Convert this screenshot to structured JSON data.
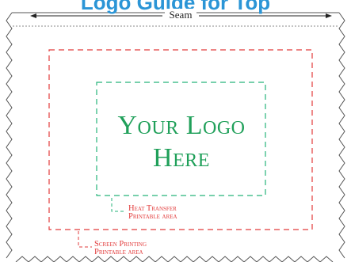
{
  "title": "Logo Guide for Top",
  "seam": {
    "label": "Seam"
  },
  "logo": {
    "line1": "Your Logo",
    "line2": "Here"
  },
  "heat_transfer": {
    "line1": "Heat Transfer",
    "line2": "Printable area",
    "color": "#26b37a"
  },
  "screen_printing": {
    "line1": "Screen Printing",
    "line2": "Printable area",
    "color": "#e23b3b"
  },
  "colors": {
    "title": "#2b95d6",
    "logo": "#20a05a",
    "outline": "#555555"
  }
}
